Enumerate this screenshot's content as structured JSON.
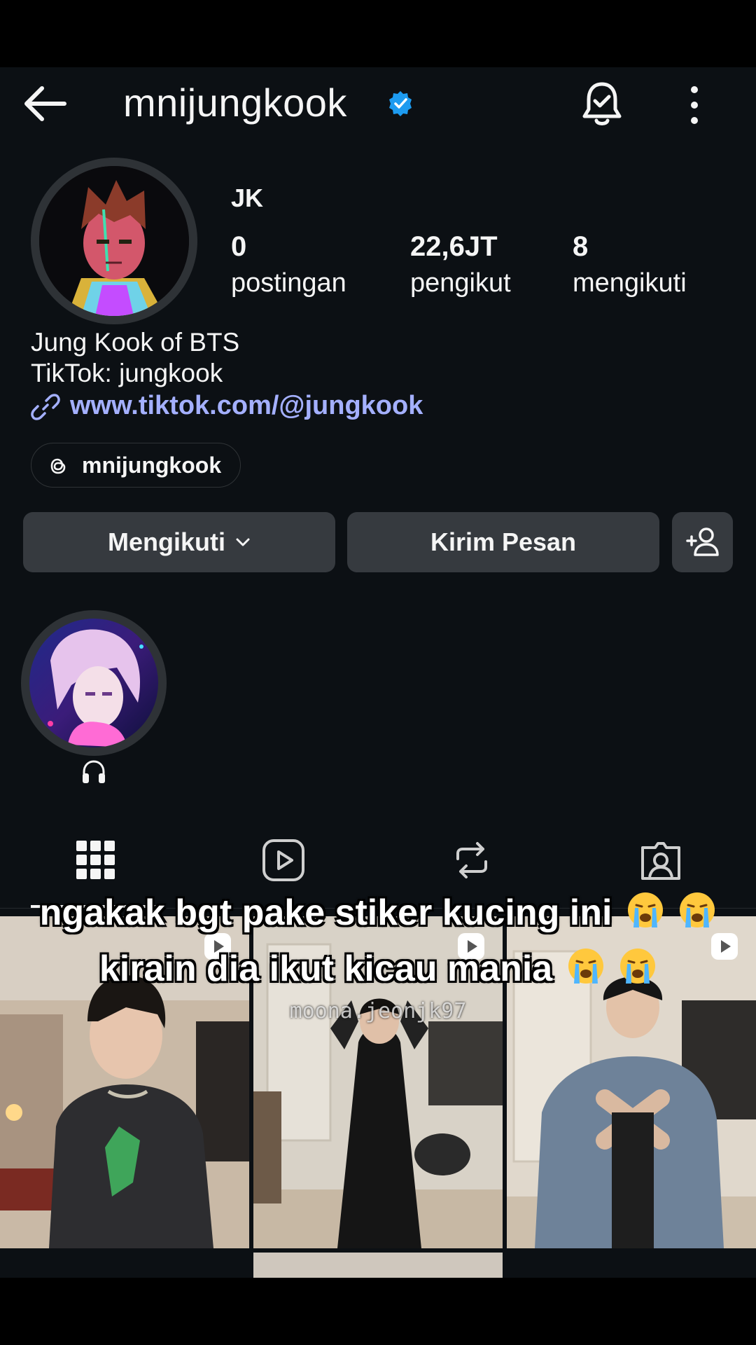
{
  "header": {
    "username": "mnijungkook",
    "icons": [
      "arrow-left-icon",
      "verified-badge-icon",
      "bell-icon",
      "more-vertical-icon"
    ]
  },
  "profile": {
    "display_name": "JK",
    "stats": [
      {
        "value": "0",
        "label": "postingan"
      },
      {
        "value": "22,6JT",
        "label": "pengikut"
      },
      {
        "value": "8",
        "label": "mengikuti"
      }
    ],
    "bio_line1": "Jung Kook of BTS",
    "bio_line2": "TikTok: jungkook",
    "link": "www.tiktok.com/@jungkook",
    "threads_handle": "mnijungkook"
  },
  "actions": {
    "follow_label": "Mengikuti",
    "message_label": "Kirim Pesan"
  },
  "highlights": [
    {
      "caption_icon": "headphones-icon"
    }
  ],
  "tabs": [
    "grid-icon",
    "reels-icon",
    "repost-icon",
    "tagged-icon"
  ],
  "overlay": {
    "line1": "ngakak bgt pake stiker kucing ini",
    "line2": "kirain dia ikut kicau mania",
    "watermark": "moona.jeonjk97"
  },
  "colors": {
    "background": "#0c1014",
    "button": "#363a3f",
    "link": "#a4b0ff",
    "verified": "#1d9bf0"
  }
}
